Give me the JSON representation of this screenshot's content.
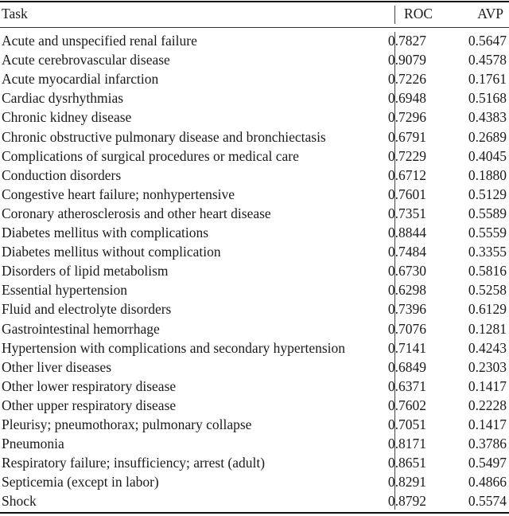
{
  "table": {
    "headers": {
      "task": "Task",
      "roc": "ROC",
      "avp": "AVP"
    },
    "rows": [
      {
        "task": "Acute and unspecified renal failure",
        "roc": "0.7827",
        "avp": "0.5647"
      },
      {
        "task": "Acute cerebrovascular disease",
        "roc": "0.9079",
        "avp": "0.4578"
      },
      {
        "task": "Acute myocardial infarction",
        "roc": "0.7226",
        "avp": "0.1761"
      },
      {
        "task": "Cardiac dysrhythmias",
        "roc": "0.6948",
        "avp": "0.5168"
      },
      {
        "task": "Chronic kidney disease",
        "roc": "0.7296",
        "avp": "0.4383"
      },
      {
        "task": "Chronic obstructive pulmonary disease and bronchiectasis",
        "roc": "0.6791",
        "avp": "0.2689"
      },
      {
        "task": "Complications of surgical procedures or medical care",
        "roc": "0.7229",
        "avp": "0.4045"
      },
      {
        "task": "Conduction disorders",
        "roc": "0.6712",
        "avp": "0.1880"
      },
      {
        "task": "Congestive heart failure; nonhypertensive",
        "roc": "0.7601",
        "avp": "0.5129"
      },
      {
        "task": "Coronary atherosclerosis and other heart disease",
        "roc": "0.7351",
        "avp": "0.5589"
      },
      {
        "task": "Diabetes mellitus with complications",
        "roc": "0.8844",
        "avp": "0.5559"
      },
      {
        "task": "Diabetes mellitus without complication",
        "roc": "0.7484",
        "avp": "0.3355"
      },
      {
        "task": "Disorders of lipid metabolism",
        "roc": "0.6730",
        "avp": "0.5816"
      },
      {
        "task": "Essential hypertension",
        "roc": "0.6298",
        "avp": "0.5258"
      },
      {
        "task": "Fluid and electrolyte disorders",
        "roc": "0.7396",
        "avp": "0.6129"
      },
      {
        "task": "Gastrointestinal hemorrhage",
        "roc": "0.7076",
        "avp": "0.1281"
      },
      {
        "task": "Hypertension with complications and secondary hypertension",
        "roc": "0.7141",
        "avp": "0.4243"
      },
      {
        "task": "Other liver diseases",
        "roc": "0.6849",
        "avp": "0.2303"
      },
      {
        "task": "Other lower respiratory disease",
        "roc": "0.6371",
        "avp": "0.1417"
      },
      {
        "task": "Other upper respiratory disease",
        "roc": "0.7602",
        "avp": "0.2228"
      },
      {
        "task": "Pleurisy; pneumothorax; pulmonary collapse",
        "roc": "0.7051",
        "avp": "0.1417"
      },
      {
        "task": "Pneumonia",
        "roc": "0.8171",
        "avp": "0.3786"
      },
      {
        "task": "Respiratory failure; insufficiency; arrest (adult)",
        "roc": "0.8651",
        "avp": "0.5497"
      },
      {
        "task": "Septicemia (except in labor)",
        "roc": "0.8291",
        "avp": "0.4866"
      },
      {
        "task": "Shock",
        "roc": "0.8792",
        "avp": "0.5574"
      }
    ]
  }
}
